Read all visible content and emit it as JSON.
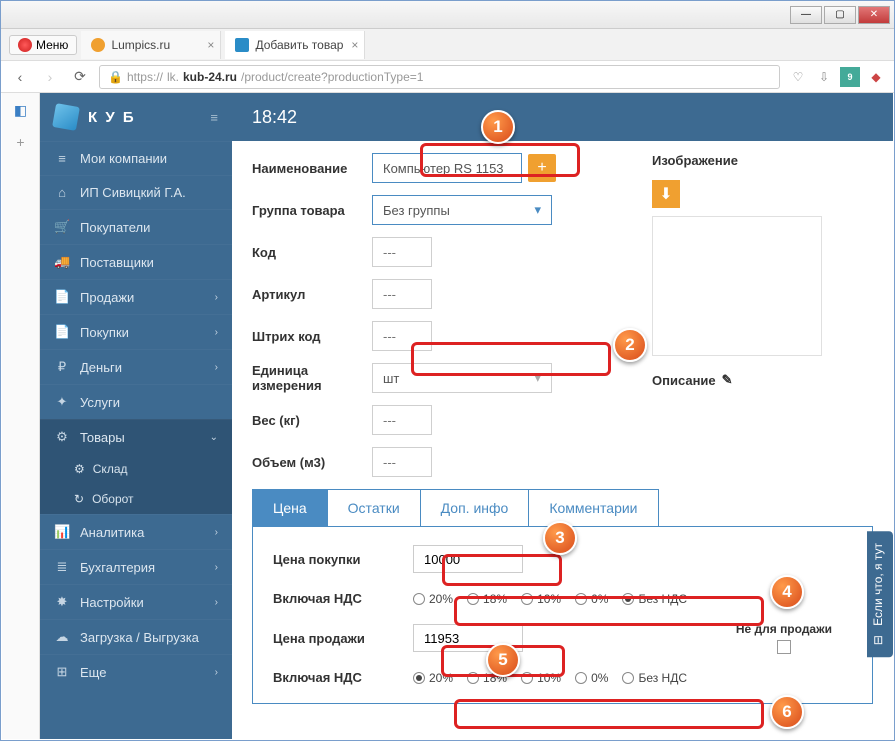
{
  "window": {
    "menu": "Меню"
  },
  "tabs": [
    {
      "title": "Lumpics.ru"
    },
    {
      "title": "Добавить товар"
    }
  ],
  "url": {
    "scheme": "https://",
    "sub": "lk.",
    "host": "kub-24.ru",
    "path": "/product/create?productionType=1"
  },
  "brand": "К У Б",
  "time": "18:42",
  "sidebar": {
    "items": [
      {
        "icon": "≡",
        "label": "Мои компании"
      },
      {
        "icon": "⌂",
        "label": "ИП Сивицкий Г.А."
      },
      {
        "icon": "🛒",
        "label": "Покупатели"
      },
      {
        "icon": "🚚",
        "label": "Поставщики"
      },
      {
        "icon": "📄",
        "label": "Продажи",
        "chev": "›"
      },
      {
        "icon": "📄",
        "label": "Покупки",
        "chev": "›"
      },
      {
        "icon": "₽",
        "label": "Деньги",
        "chev": "›"
      },
      {
        "icon": "✦",
        "label": "Услуги"
      },
      {
        "icon": "⚙",
        "label": "Товары",
        "chev": "⌄",
        "active": true
      },
      {
        "icon": "📊",
        "label": "Аналитика",
        "chev": "›"
      },
      {
        "icon": "≣",
        "label": "Бухгалтерия",
        "chev": "›"
      },
      {
        "icon": "✸",
        "label": "Настройки",
        "chev": "›"
      },
      {
        "icon": "☁",
        "label": "Загрузка / Выгрузка"
      },
      {
        "icon": "⊞",
        "label": "Еще",
        "chev": "›"
      }
    ],
    "subitems": [
      {
        "icon": "⚙",
        "label": "Склад"
      },
      {
        "icon": "↻",
        "label": "Оборот"
      }
    ]
  },
  "form": {
    "name_label": "Наименование",
    "name_value": "Компьютер RS 1153",
    "group_label": "Группа товара",
    "group_value": "Без группы",
    "code_label": "Код",
    "article_label": "Артикул",
    "barcode_label": "Штрих код",
    "unit_label1": "Единица",
    "unit_label2": "измерения",
    "unit_value": "шт",
    "weight_label": "Вес (кг)",
    "volume_label": "Объем (м3)",
    "dash": "---"
  },
  "right": {
    "image_label": "Изображение",
    "desc_label": "Описание"
  },
  "ptabs": [
    "Цена",
    "Остатки",
    "Доп. инфо",
    "Комментарии"
  ],
  "price": {
    "buy_label": "Цена покупки",
    "buy_value": "10000",
    "vat_label": "Включая НДС",
    "sell_label": "Цена продажи",
    "sell_value": "11953",
    "not_for_sale": "Не для продажи",
    "vat_options": [
      "20%",
      "18%",
      "10%",
      "0%",
      "Без НДС"
    ]
  },
  "help_tab": "Если что, я тут",
  "callouts": [
    "1",
    "2",
    "3",
    "4",
    "5",
    "6"
  ]
}
